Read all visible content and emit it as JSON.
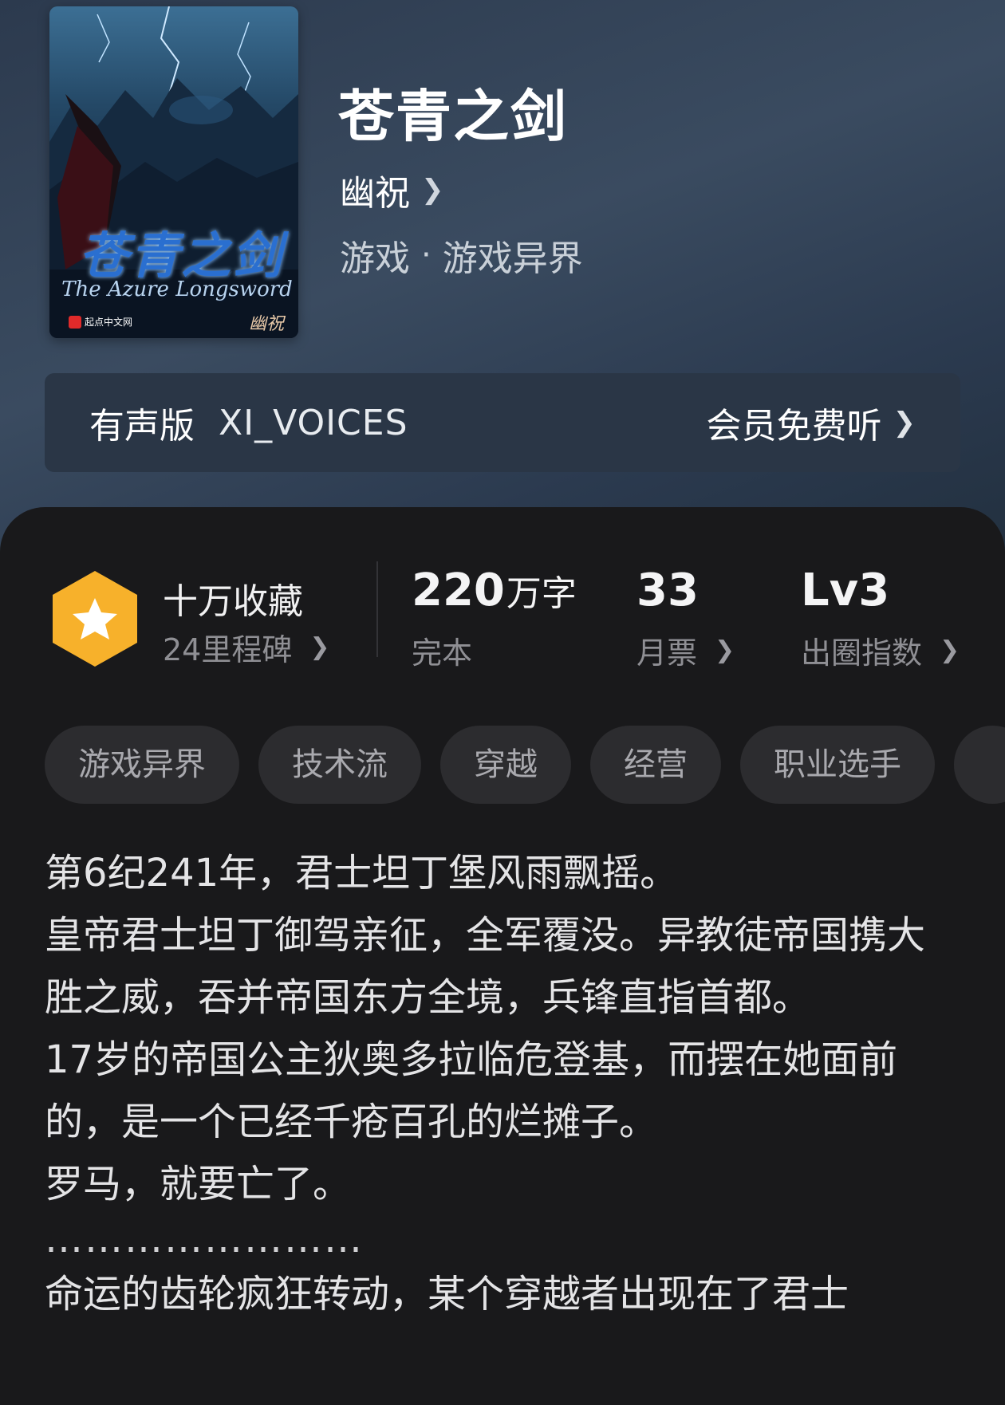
{
  "book": {
    "title": "苍青之剑",
    "author": "幽祝",
    "genre": "游戏",
    "subgenre": "游戏异界",
    "genre_separator": "·"
  },
  "cover": {
    "title_art": "苍青之剑",
    "subtitle_art": "The Azure Longsword",
    "publisher": "起点中文网",
    "author_art": "幽祝 著"
  },
  "audio": {
    "label": "有声版",
    "voice_name": "XI_VOICES",
    "cta": "会员免费听"
  },
  "stats": {
    "collect_main": "十万收藏",
    "collect_sub": "24里程碑",
    "words_num": "220",
    "words_unit": "万字",
    "words_status": "完本",
    "votes_num": "33",
    "votes_label": "月票",
    "level": "Lv3",
    "level_label": "出圈指数"
  },
  "tags": [
    "游戏异界",
    "技术流",
    "穿越",
    "经营",
    "职业选手"
  ],
  "description": [
    "第6纪241年，君士坦丁堡风雨飘摇。",
    "皇帝君士坦丁御驾亲征，全军覆没。异教徒帝国携大胜之威，吞并帝国东方全境，兵锋直指首都。",
    "17岁的帝国公主狄奥多拉临危登基，而摆在她面前的，是一个已经千疮百孔的烂摊子。",
    "罗马，就要亡了。",
    "……………………",
    "命运的齿轮疯狂转动，某个穿越者出现在了君士"
  ],
  "colors": {
    "badge": "#f7b12b",
    "hero_bg": "#34445a",
    "panel_bg": "#19191b"
  }
}
